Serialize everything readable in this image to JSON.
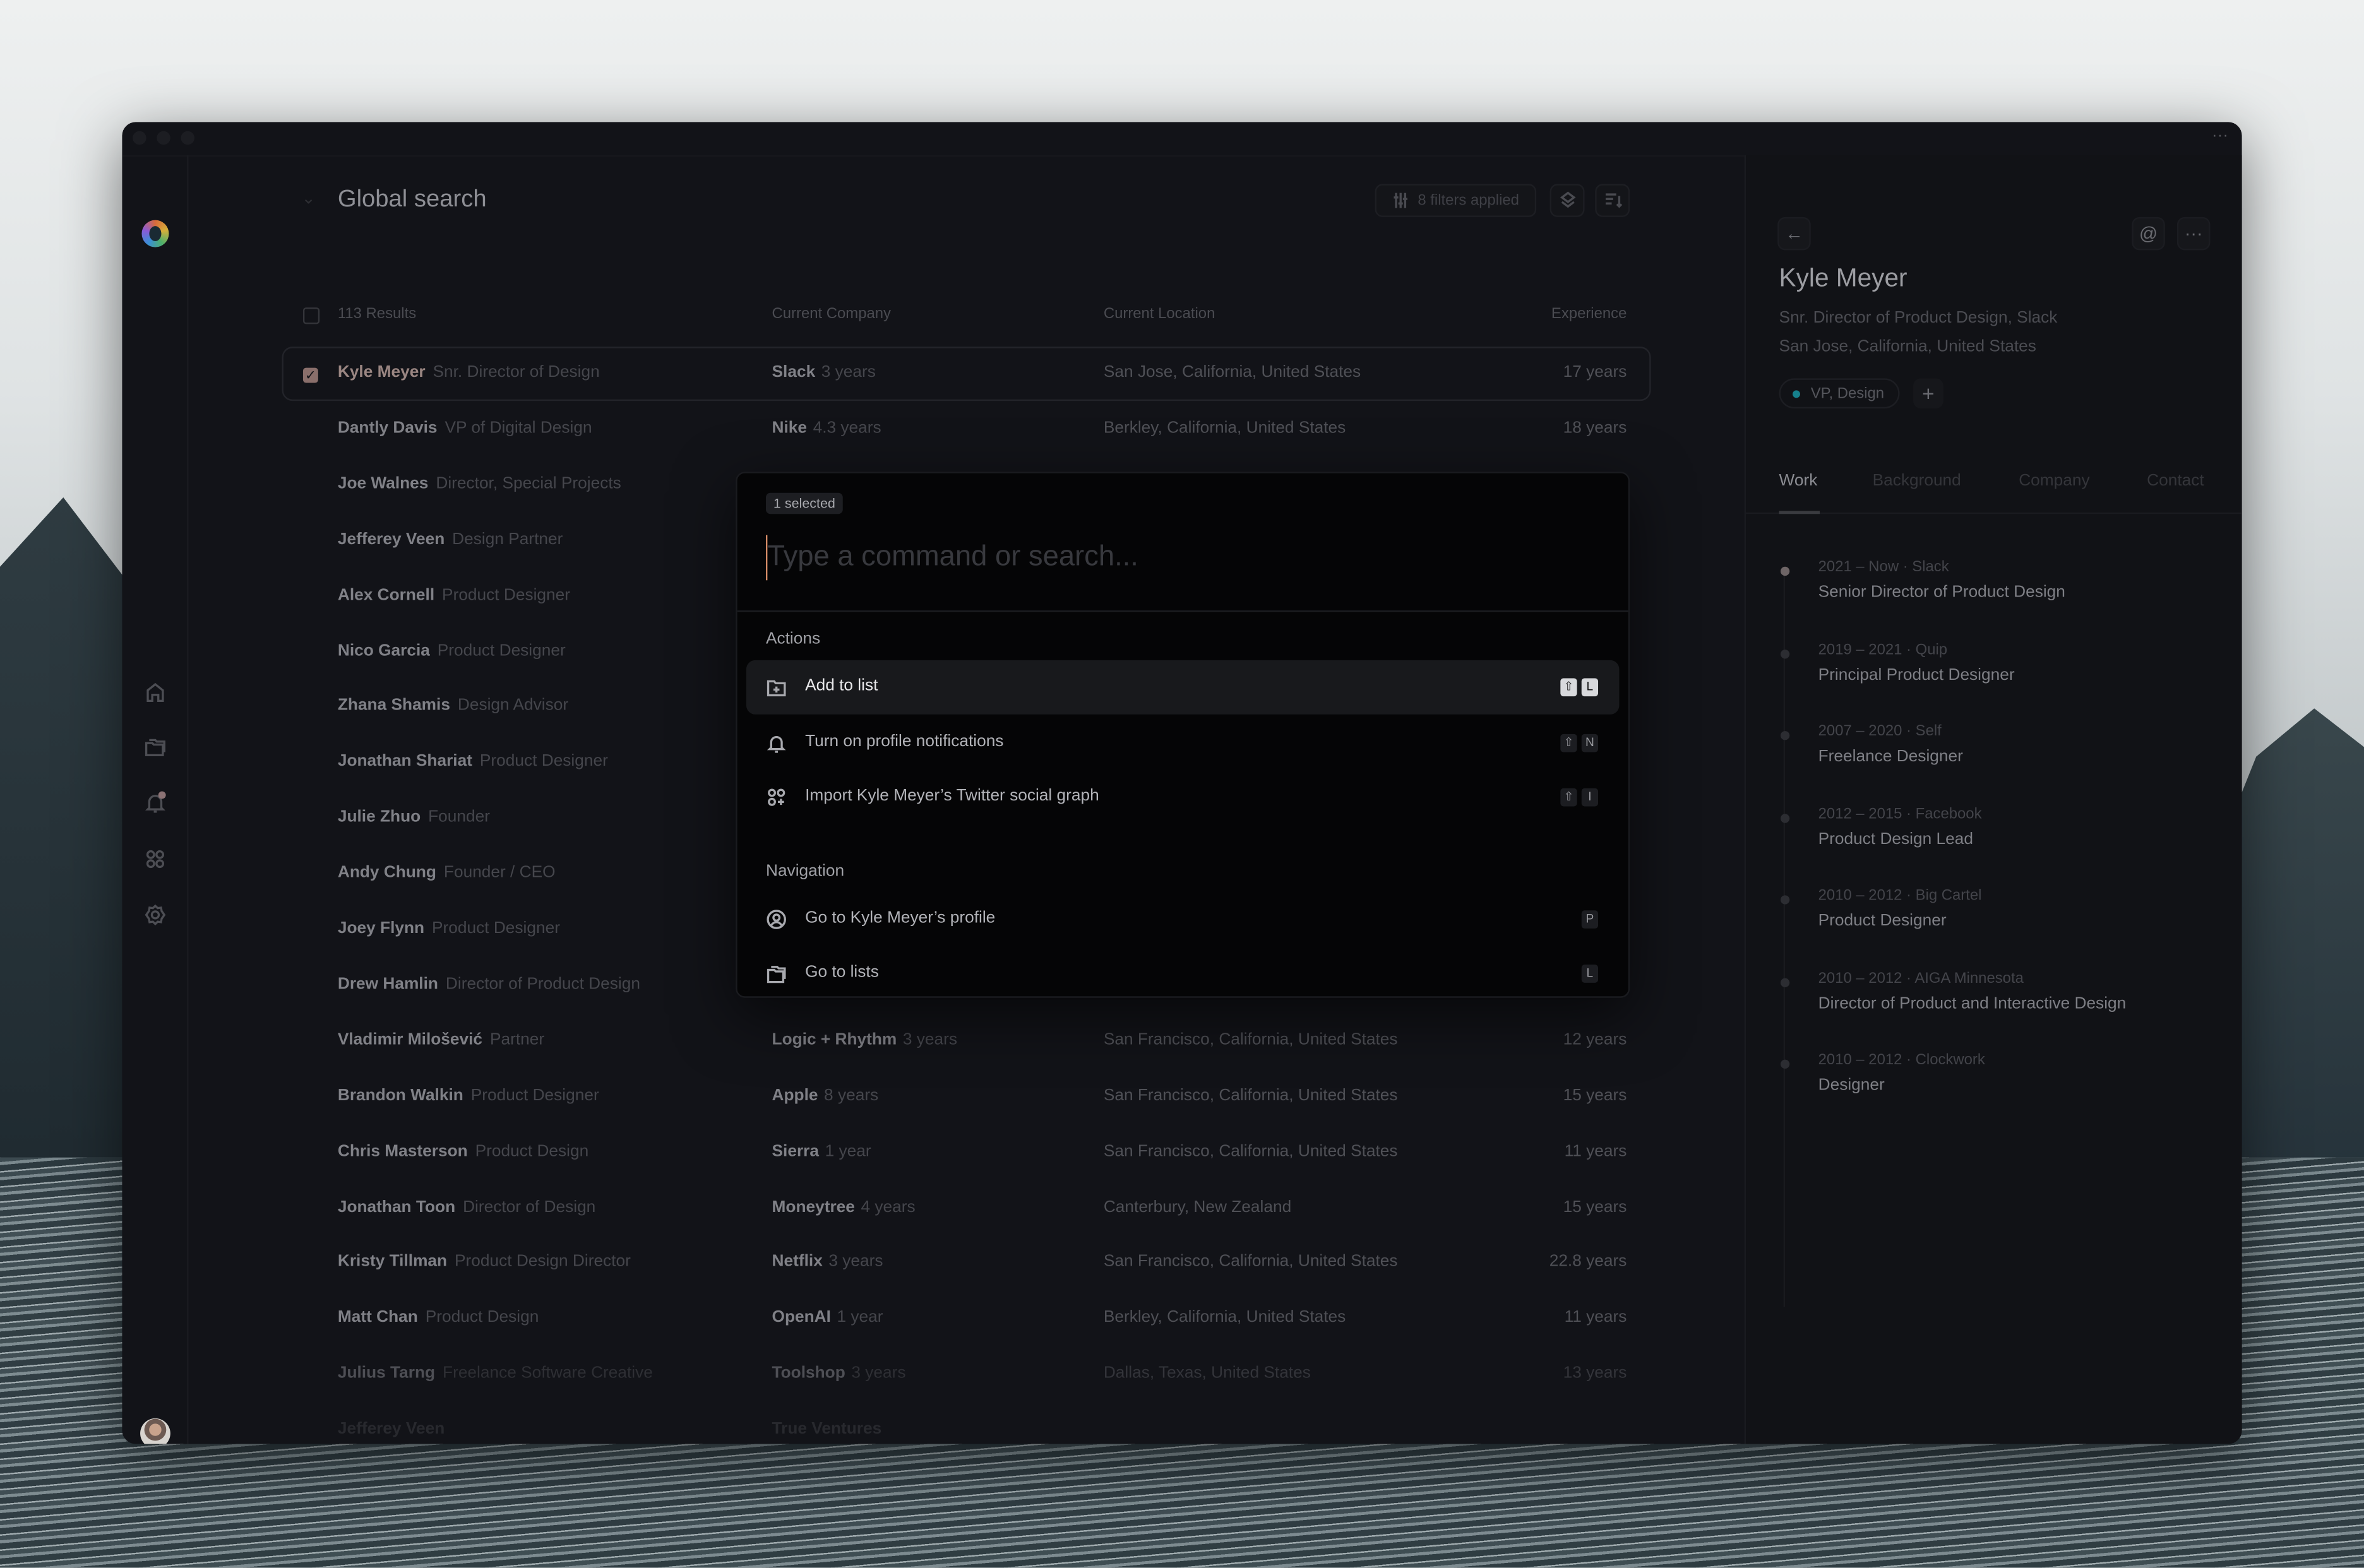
{
  "window": {
    "title_menu_icon": "more-horizontal-icon"
  },
  "header": {
    "title": "Global search",
    "filters_label": "8 filters applied"
  },
  "table": {
    "results_label": "113 Results",
    "columns": {
      "company": "Current Company",
      "location": "Current Location",
      "experience": "Experience"
    },
    "rows": [
      {
        "name": "Kyle Meyer",
        "title": "Snr. Director of Design",
        "company": "Slack",
        "tenure": "3 years",
        "location": "San Jose, California, United States",
        "experience": "17 years",
        "selected": true
      },
      {
        "name": "Dantly Davis",
        "title": "VP of Digital Design",
        "company": "Nike",
        "tenure": "4.3 years",
        "location": "Berkley, California, United States",
        "experience": "18 years"
      },
      {
        "name": "Joe Walnes",
        "title": "Director, Special Projects"
      },
      {
        "name": "Jefferey Veen",
        "title": "Design Partner"
      },
      {
        "name": "Alex Cornell",
        "title": "Product Designer"
      },
      {
        "name": "Nico Garcia",
        "title": "Product Designer"
      },
      {
        "name": "Zhana Shamis",
        "title": "Design Advisor"
      },
      {
        "name": "Jonathan Shariat",
        "title": "Product Designer"
      },
      {
        "name": "Julie Zhuo",
        "title": "Founder"
      },
      {
        "name": "Andy Chung",
        "title": "Founder / CEO"
      },
      {
        "name": "Joey Flynn",
        "title": "Product Designer"
      },
      {
        "name": "Drew Hamlin",
        "title": "Director of Product Design"
      },
      {
        "name": "Vladimir Milošević",
        "title": "Partner",
        "company": "Logic + Rhythm",
        "tenure": "3 years",
        "location": "San Francisco, California, United States",
        "experience": "12 years"
      },
      {
        "name": "Brandon Walkin",
        "title": "Product Designer",
        "company": "Apple",
        "tenure": "8 years",
        "location": "San Francisco, California, United States",
        "experience": "15 years"
      },
      {
        "name": "Chris Masterson",
        "title": "Product Design",
        "company": "Sierra",
        "tenure": "1 year",
        "location": "San Francisco, California, United States",
        "experience": "11 years"
      },
      {
        "name": "Jonathan Toon",
        "title": "Director of Design",
        "company": "Moneytree",
        "tenure": "4 years",
        "location": "Canterbury, New Zealand",
        "experience": "15 years"
      },
      {
        "name": "Kristy Tillman",
        "title": "Product Design Director",
        "company": "Netflix",
        "tenure": "3 years",
        "location": "San Francisco, California, United States",
        "experience": "22.8 years"
      },
      {
        "name": "Matt Chan",
        "title": "Product Design",
        "company": "OpenAI",
        "tenure": "1 year",
        "location": "Berkley, California, United States",
        "experience": "11 years"
      },
      {
        "name": "Julius Tarng",
        "title": "Freelance Software Creative",
        "company": "Toolshop",
        "tenure": "3 years",
        "location": "Dallas, Texas, United States",
        "experience": "13 years"
      },
      {
        "name": "Jefferey Veen",
        "title": "",
        "company": "True Ventures",
        "tenure": "",
        "location": "",
        "experience": ""
      }
    ]
  },
  "palette": {
    "badge": "1 selected",
    "placeholder": "Type a command or search...",
    "sections": [
      {
        "label": "Actions",
        "items": [
          {
            "label": "Add to list",
            "icon": "folder-plus-icon",
            "keys": [
              "⇧",
              "L"
            ],
            "highlighted": true
          },
          {
            "label": "Turn on profile notifications",
            "icon": "bell-icon",
            "keys": [
              "⇧",
              "N"
            ]
          },
          {
            "label": "Import Kyle Meyer’s Twitter social graph",
            "icon": "circles-plus-icon",
            "keys": [
              "⇧",
              "I"
            ]
          }
        ]
      },
      {
        "label": "Navigation",
        "items": [
          {
            "label": "Go to Kyle Meyer’s profile",
            "icon": "user-circle-icon",
            "keys": [
              "P"
            ]
          },
          {
            "label": "Go to lists",
            "icon": "folders-icon",
            "keys": [
              "L"
            ]
          }
        ]
      }
    ]
  },
  "profile": {
    "name": "Kyle Meyer",
    "headline": "Snr. Director of Product Design, Slack",
    "location": "San Jose, California, United States",
    "tag": "VP, Design",
    "tag_color": "#16808c",
    "tabs": [
      "Work",
      "Background",
      "Company",
      "Contact"
    ],
    "active_tab": "Work",
    "work": [
      {
        "meta": "2021 – Now · Slack",
        "role": "Senior Director of Product Design"
      },
      {
        "meta": "2019 – 2021 · Quip",
        "role": "Principal Product Designer"
      },
      {
        "meta": "2007 – 2020 · Self",
        "role": "Freelance Designer"
      },
      {
        "meta": "2012 – 2015 · Facebook",
        "role": "Product Design Lead"
      },
      {
        "meta": "2010 – 2012 · Big Cartel",
        "role": "Product Designer"
      },
      {
        "meta": "2010 – 2012 · AIGA Minnesota",
        "role": "Director of Product and Interactive Design"
      },
      {
        "meta": "2010 – 2012 · Clockwork",
        "role": "Designer"
      }
    ]
  }
}
